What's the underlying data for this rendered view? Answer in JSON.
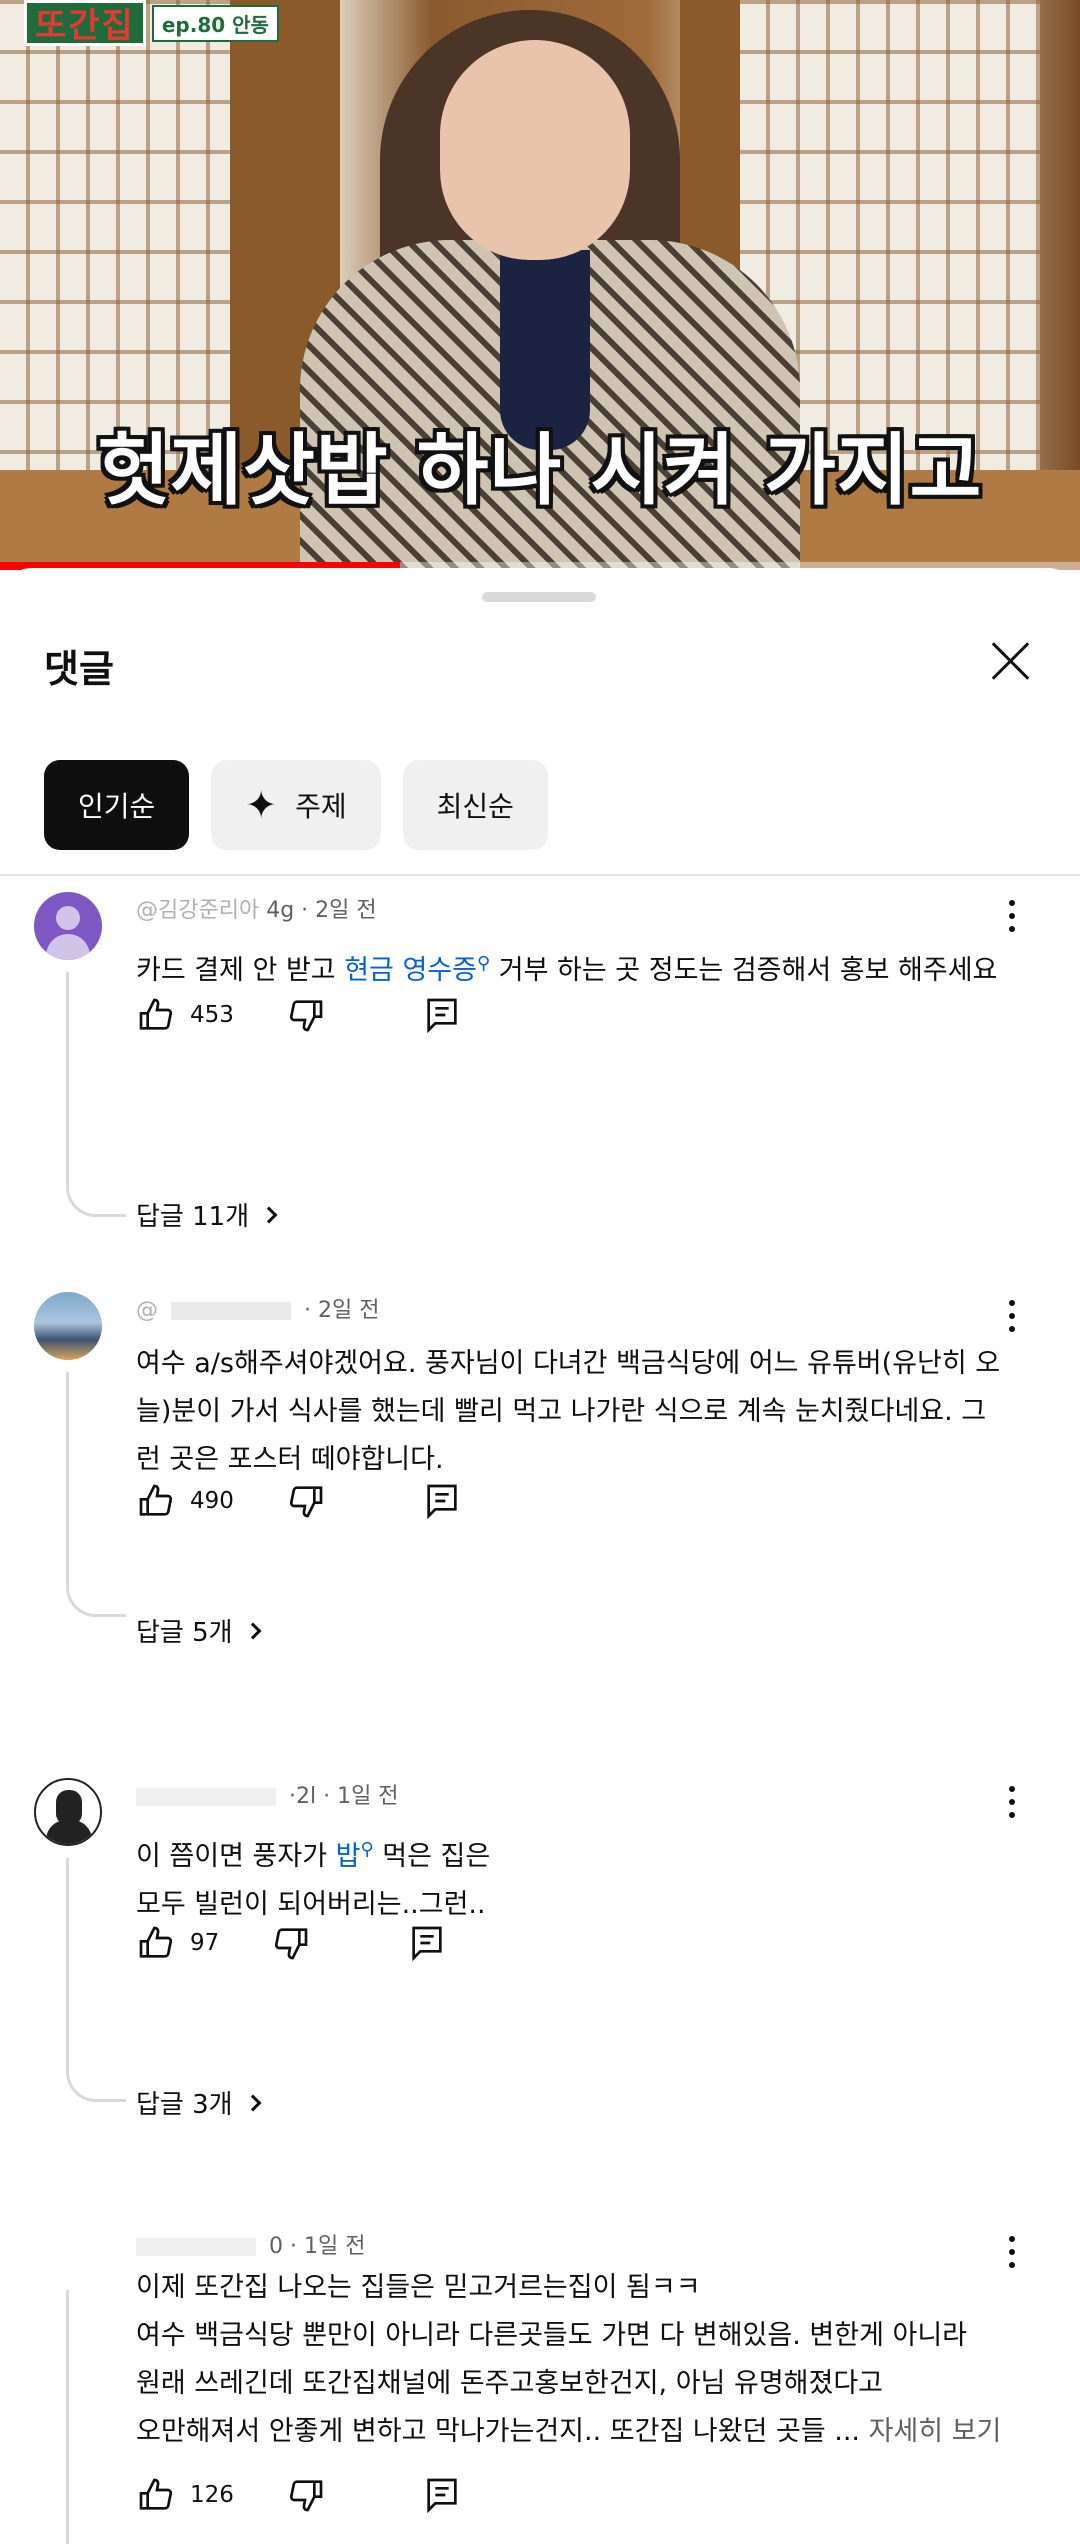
{
  "video": {
    "logo_title": "또간집",
    "logo_episode": "ep.80 안동",
    "subtitle": "헛제삿밥 하나 시켜 가지고",
    "progress_fraction": 0.37
  },
  "sheet": {
    "title": "댓글",
    "close_icon": "close-icon",
    "chips": [
      {
        "label": "인기순",
        "active": true
      },
      {
        "label": "주제",
        "icon": "sparkle-icon",
        "active": false
      },
      {
        "label": "최신순",
        "active": false
      }
    ]
  },
  "comments": [
    {
      "handle": "@김강준리아",
      "time": "4g · 2일 전",
      "text_before": "카드 결제 안 받고 ",
      "link": "현금 영수증",
      "text_after": " 거부 하는 곳 정도는 검증해서 홍보 해주세요",
      "likes": "453",
      "replies": "답글 11개"
    },
    {
      "handle": "@",
      "time": "· 2일 전",
      "text": "여수 a/s해주셔야겠어요. 풍자님이 다녀간 백금식당에 어느 유튜버(유난히 오늘)분이 가서 식사를 했는데 빨리 먹고 나가란 식으로 계속 눈치줬다네요. 그런 곳은 포스터 떼야합니다.",
      "likes": "490",
      "replies": "답글 5개"
    },
    {
      "handle": "@",
      "time": "·2l · 1일 전",
      "text_before": "이 쯤이면 풍자가 ",
      "link": "밥",
      "text_after": " 먹은 집은",
      "text_line2": "모두 빌런이 되어버리는..그런..",
      "likes": "97",
      "replies": "답글 3개"
    },
    {
      "handle": "@",
      "time": "0 · 1일 전",
      "line1": "이제 또간집 나오는 집들은 믿고거르는집이 됨ㅋㅋ",
      "line2": "여수 백금식당 뿐만이 아니라 다른곳들도 가면 다 변해있음. 변한게 아니라",
      "line3": "원래 쓰레긴데 또간집채널에 돈주고홍보한건지, 아님 유명해졌다고",
      "line4": "오만해져서 안좋게 변하고 막나가는건지.. 또간집 나왔던 곳들 ...",
      "more": "자세히 보기",
      "likes": "126"
    }
  ]
}
